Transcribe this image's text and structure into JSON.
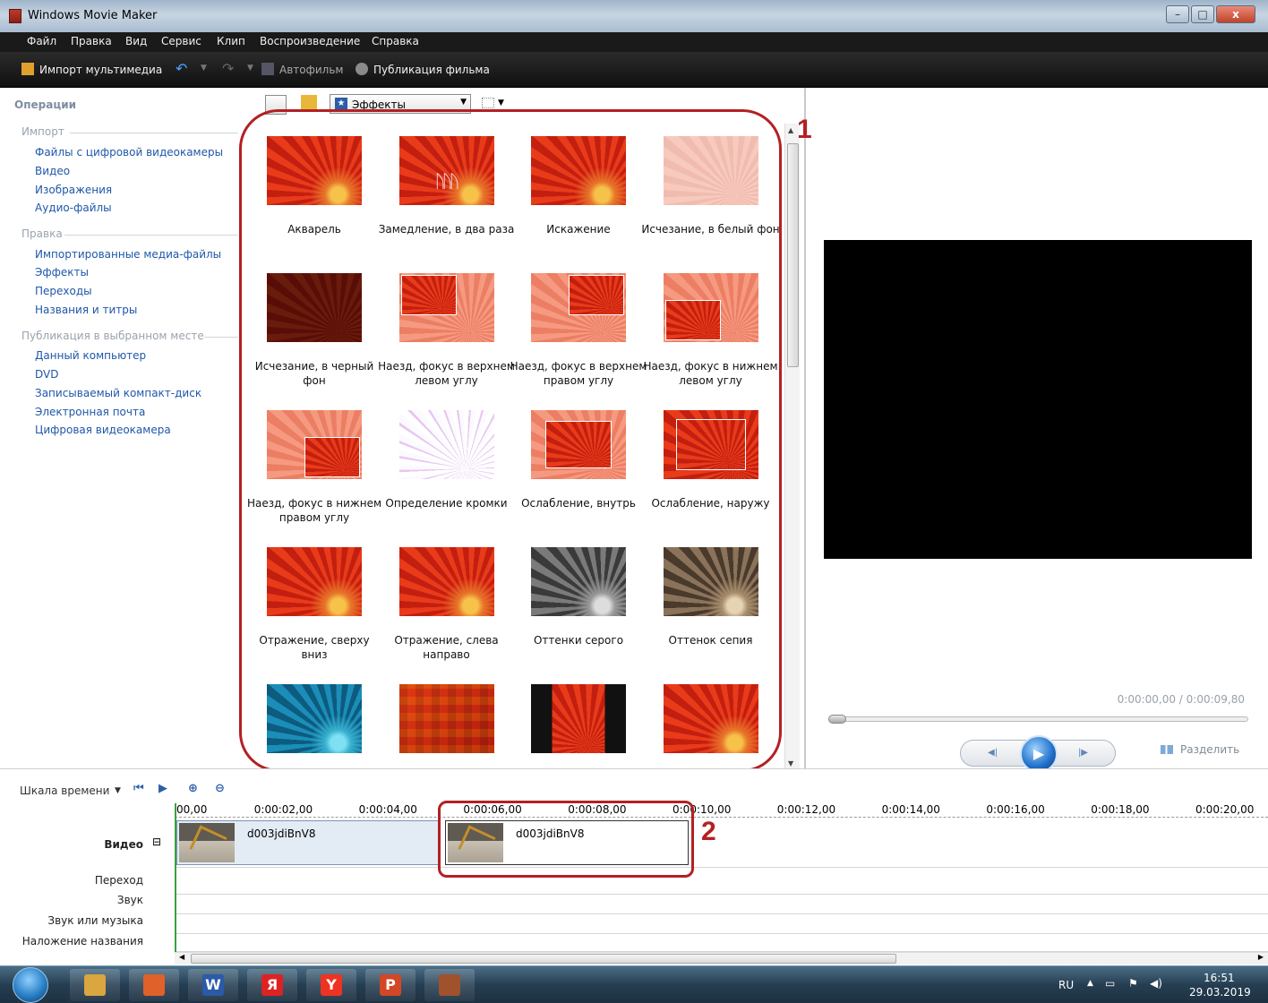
{
  "window": {
    "title": "Windows Movie Maker",
    "controls": [
      "–",
      "□",
      "x"
    ]
  },
  "menu": [
    "Файл",
    "Правка",
    "Вид",
    "Сервис",
    "Клип",
    "Воспроизведение",
    "Справка"
  ],
  "toolbar": {
    "import": "Импорт мультимедиа",
    "autofilm": "Автофильм",
    "publish": "Публикация фильма"
  },
  "tasks": {
    "title": "Операции",
    "sections": [
      {
        "head": "Импорт",
        "links": [
          "Файлы с цифровой видеокамеры",
          "Видео",
          "Изображения",
          "Аудио-файлы"
        ]
      },
      {
        "head": "Правка",
        "links": [
          "Импортированные медиа-файлы",
          "Эффекты",
          "Переходы",
          "Названия и титры"
        ]
      },
      {
        "head": "Публикация в выбранном месте",
        "links": [
          "Данный компьютер",
          "DVD",
          "Записываемый компакт-диск",
          "Электронная почта",
          "Цифровая видеокамера"
        ]
      }
    ]
  },
  "collections": {
    "dropdown": "Эффекты",
    "effects": [
      {
        "label": "Акварель",
        "style": "normal"
      },
      {
        "label": "Замедление, в два раза",
        "style": "walkers"
      },
      {
        "label": "Искажение",
        "style": "normal"
      },
      {
        "label": "Исчезание, в белый фон",
        "style": "white"
      },
      {
        "label": "Исчезание, в черный фон",
        "style": "dark"
      },
      {
        "label": "Наезд, фокус в верхнем левом углу",
        "style": "tl"
      },
      {
        "label": "Наезд, фокус в верхнем правом углу",
        "style": "tr"
      },
      {
        "label": "Наезд, фокус в нижнем левом углу",
        "style": "bl"
      },
      {
        "label": "Наезд, фокус в нижнем правом углу",
        "style": "br"
      },
      {
        "label": "Определение кромки",
        "style": "edge"
      },
      {
        "label": "Ослабление, внутрь",
        "style": "in"
      },
      {
        "label": "Ослабление, наружу",
        "style": "out"
      },
      {
        "label": "Отражение, сверху вниз",
        "style": "normal"
      },
      {
        "label": "Отражение, слева направо",
        "style": "normal"
      },
      {
        "label": "Оттенки серого",
        "style": "gray"
      },
      {
        "label": "Оттенок сепия",
        "style": "sepia"
      },
      {
        "label": "",
        "style": "blue"
      },
      {
        "label": "",
        "style": "pixel"
      },
      {
        "label": "",
        "style": "bars"
      },
      {
        "label": "",
        "style": "normal"
      }
    ]
  },
  "preview": {
    "time": "0:00:00,00 / 0:00:09,80",
    "split": "Разделить",
    "play_glyph": "▶",
    "prev_glyph": "◀|",
    "next_glyph": "|▶"
  },
  "annotations": [
    "1",
    "2"
  ],
  "timeline": {
    "label": "Шкала времени",
    "ticks": [
      "00,00",
      "0:00:02,00",
      "0:00:04,00",
      "0:00:06,00",
      "0:00:08,00",
      "0:00:10,00",
      "0:00:12,00",
      "0:00:14,00",
      "0:00:16,00",
      "0:00:18,00",
      "0:00:20,00"
    ],
    "tracks": [
      "Видео",
      "Переход",
      "Звук",
      "Звук или музыка",
      "Наложение названия"
    ],
    "collapse_glyph": "⊟",
    "clips": [
      "d003jdiBnV8",
      "d003jdiBnV8"
    ]
  },
  "taskbar": {
    "lang": "RU",
    "time": "16:51",
    "date": "29.03.2019",
    "apps": [
      {
        "name": "explorer",
        "glyph": "",
        "color": "#d9a640"
      },
      {
        "name": "media",
        "glyph": "",
        "color": "#e0612a"
      },
      {
        "name": "word",
        "glyph": "W",
        "color": "#2b5aa8"
      },
      {
        "name": "yandex",
        "glyph": "Я",
        "color": "#d22"
      },
      {
        "name": "yandex-browser",
        "glyph": "Y",
        "color": "#e32"
      },
      {
        "name": "powerpoint",
        "glyph": "P",
        "color": "#d24726"
      },
      {
        "name": "movie-maker",
        "glyph": "",
        "color": "#a0522d"
      }
    ]
  }
}
